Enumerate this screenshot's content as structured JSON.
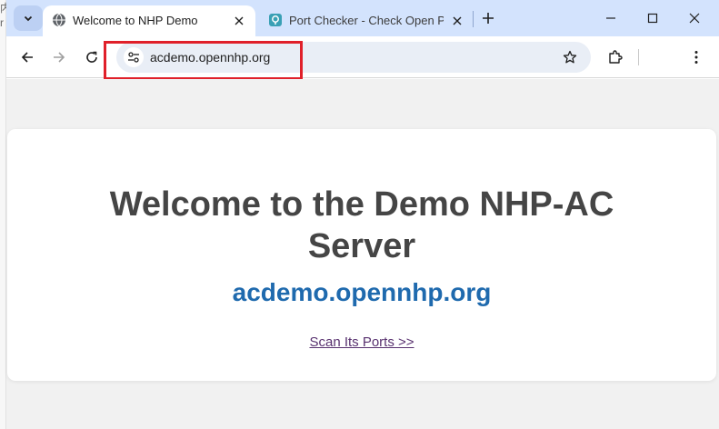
{
  "left_edge": {
    "text_top": "内",
    "text_second": "r"
  },
  "tabs": [
    {
      "title": "Welcome to NHP Demo",
      "favicon": "globe-icon",
      "active": true
    },
    {
      "title": "Port Checker - Check Open P",
      "favicon": "port-checker-icon",
      "active": false
    }
  ],
  "toolbar": {
    "url": "acdemo.opennhp.org"
  },
  "page": {
    "heading": "Welcome to the Demo NHP-AC Server",
    "domain": "acdemo.opennhp.org",
    "link": "Scan Its Ports >>"
  },
  "colors": {
    "tabstrip": "#d3e3fd",
    "heading": "#454545",
    "domain": "#1f6aae",
    "link": "#58316f",
    "highlight": "#e0202a"
  }
}
